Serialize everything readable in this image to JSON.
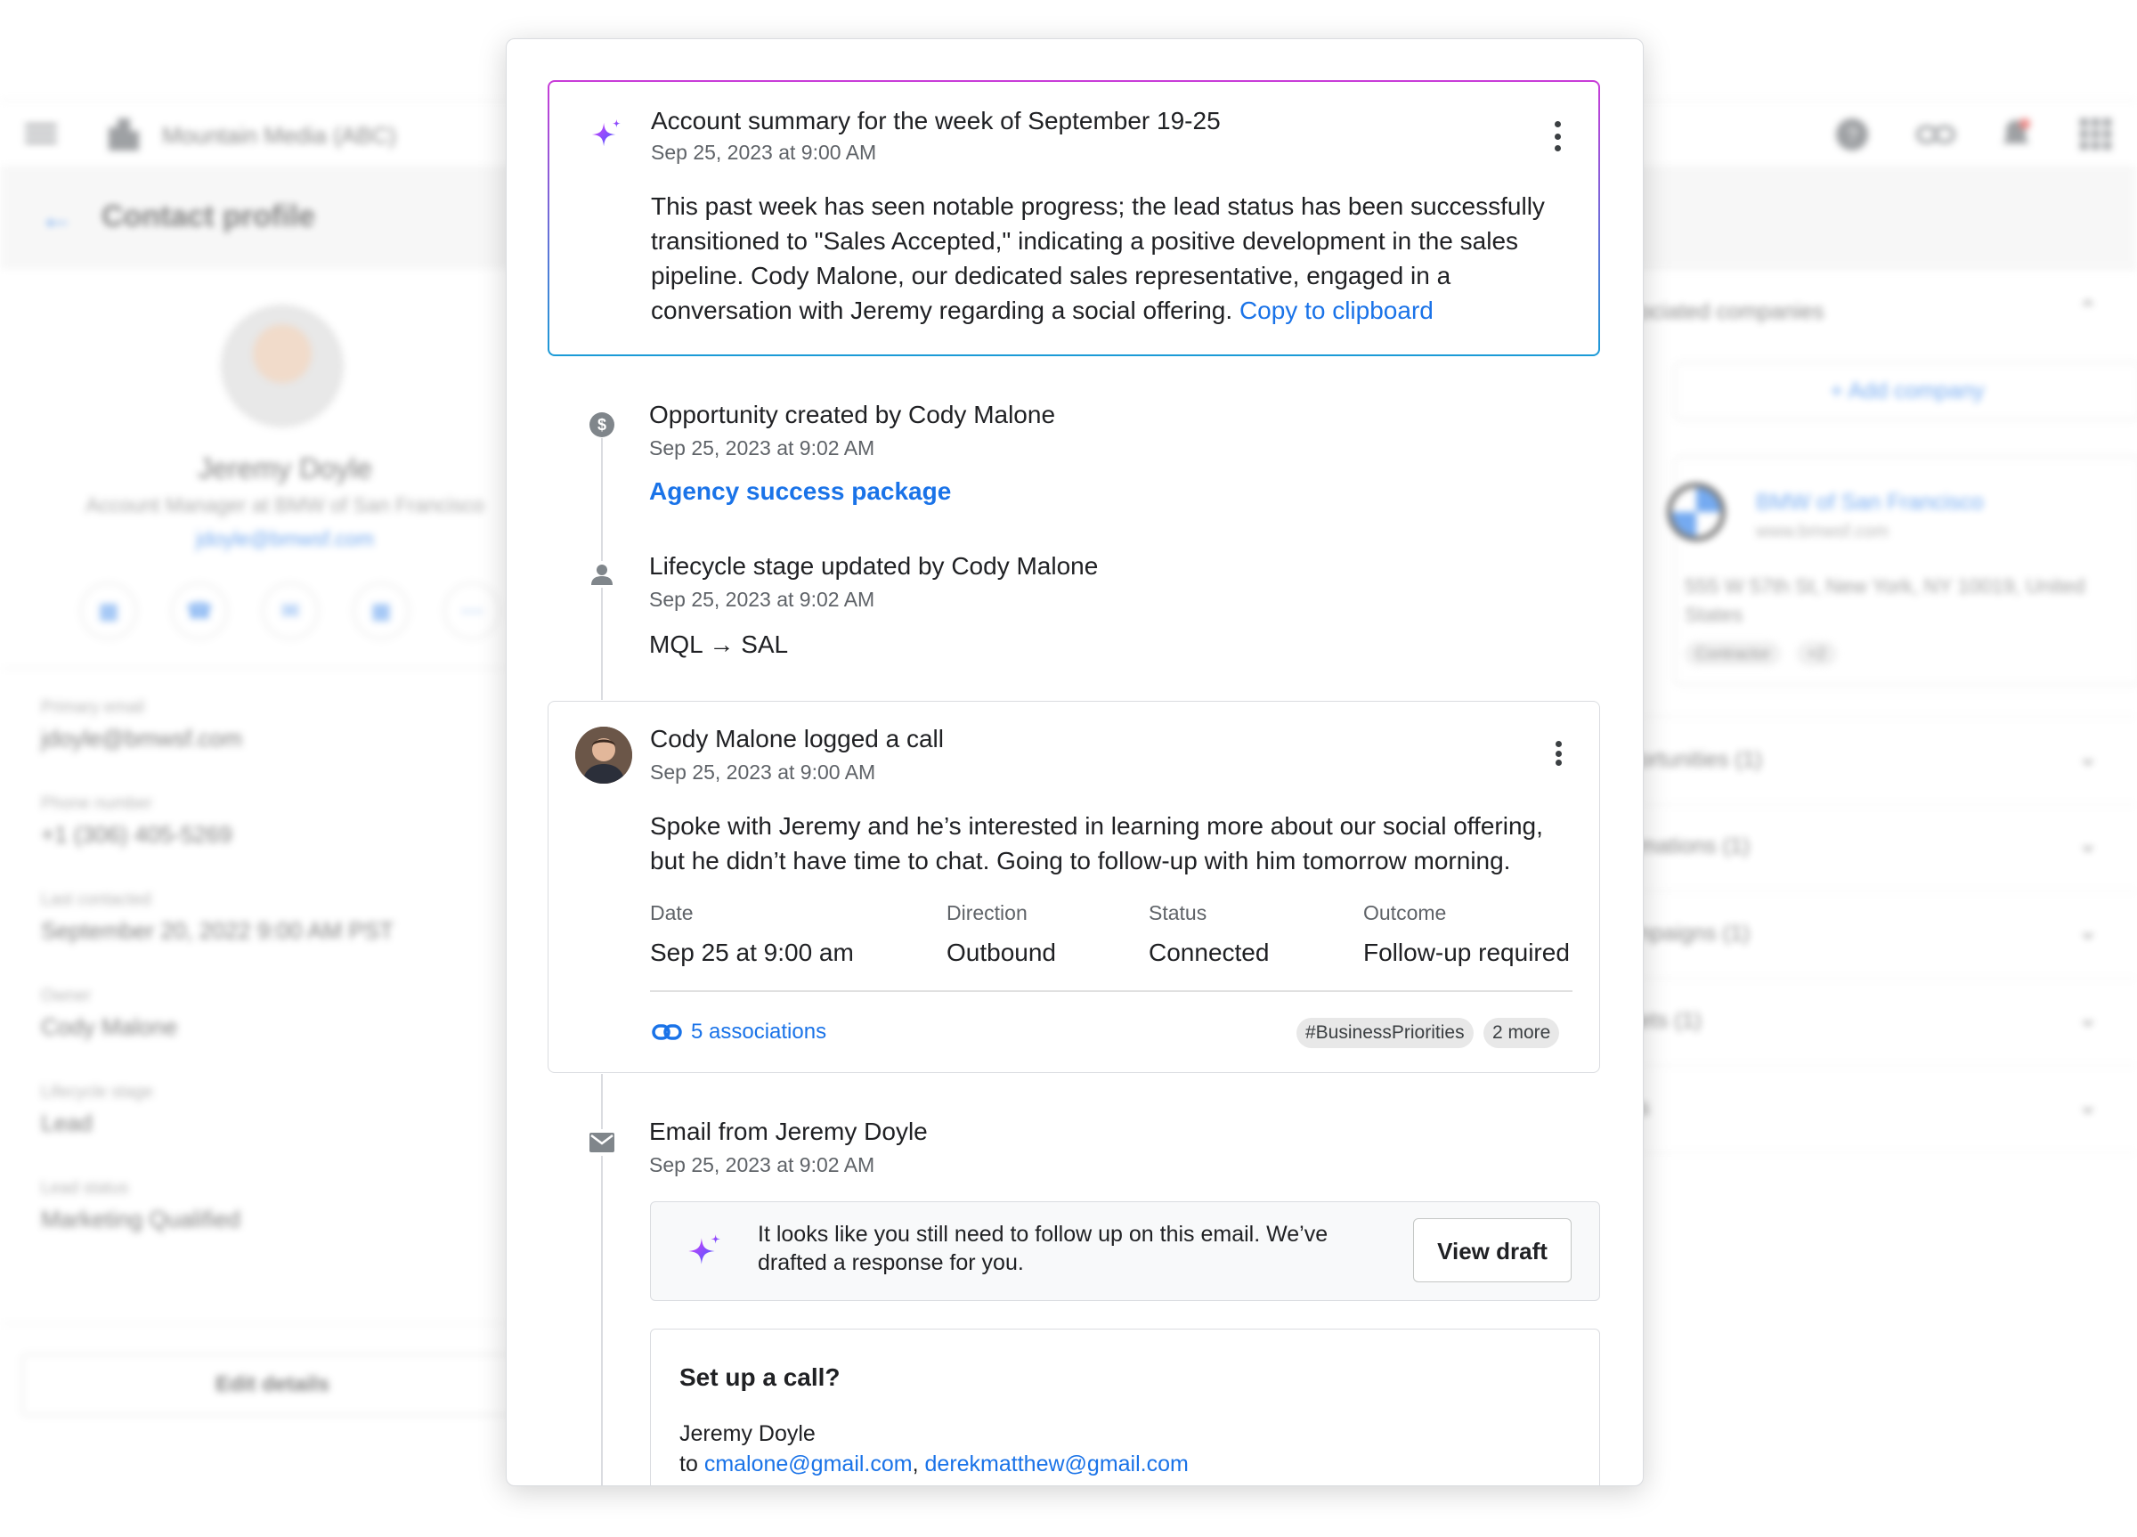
{
  "background": {
    "org_name": "Mountain Media (ABC)",
    "page_title": "Contact profile",
    "contact": {
      "name": "Jeremy Doyle",
      "role": "Account Manager at BMW of San Francisco",
      "email": "jdoyle@bmwsf.com"
    },
    "fields": [
      {
        "label": "Primary email",
        "value": "jdoyle@bmwsf.com"
      },
      {
        "label": "Phone number",
        "value": "+1 (306) 405-5269"
      },
      {
        "label": "Last contacted",
        "value": "September 20, 2022 9:00 AM PST"
      },
      {
        "label": "Owner",
        "value": "Cody Malone"
      },
      {
        "label": "Lifecycle stage",
        "value": "Lead"
      },
      {
        "label": "Lead status",
        "value": "Marketing Qualified"
      }
    ],
    "edit_details_label": "Edit details",
    "right_panel": {
      "associated_companies_title": "ociated companies",
      "add_company_label": "+ Add company",
      "company": {
        "name": "BMW of San Francisco",
        "url": "www.bmwsf.com",
        "address": "555 W 57th St, New York, NY 10019, United States",
        "tag": "Contractor",
        "extra_tag": "+2"
      },
      "sections": [
        "ortunities (1)",
        "mations (1)",
        "npaigns (1)",
        "ets (1)",
        "s"
      ]
    }
  },
  "summary": {
    "title": "Account summary for the week of September 19-25",
    "timestamp": "Sep 25, 2023 at 9:00 AM",
    "body": "This past week has seen notable progress; the lead status has been successfully transitioned to \"Sales Accepted,\" indicating a positive development in the sales pipeline. Cody Malone, our dedicated sales representative, engaged in a conversation with Jeremy regarding a social offering.",
    "copy_link": "Copy to clipboard"
  },
  "opportunity": {
    "title": "Opportunity created by Cody Malone",
    "timestamp": "Sep 25, 2023 at 9:02 AM",
    "link": "Agency success package"
  },
  "lifecycle": {
    "title": "Lifecycle stage updated by Cody Malone",
    "timestamp": "Sep 25, 2023 at 9:02 AM",
    "change": "MQL → SAL"
  },
  "call": {
    "title": "Cody Malone logged a call",
    "timestamp": "Sep 25, 2023 at 9:00 AM",
    "body": "Spoke with Jeremy and he’s interested in learning more about our social offering, but he didn’t have time to chat. Going to follow-up with him tomorrow morning.",
    "details": [
      {
        "label": "Date",
        "value": "Sep 25 at 9:00 am"
      },
      {
        "label": "Direction",
        "value": "Outbound"
      },
      {
        "label": "Status",
        "value": "Connected"
      },
      {
        "label": "Outcome",
        "value": "Follow-up required"
      }
    ],
    "associations": "5 associations",
    "tag": "#BusinessPriorities",
    "more": "2 more"
  },
  "email": {
    "title": "Email from Jeremy Doyle",
    "timestamp": "Sep 25, 2023 at 9:02 AM",
    "ai_suggestion": "It looks like you still need to follow up on this email. We’ve drafted a response for you.",
    "view_draft": "View draft",
    "draft": {
      "subject": "Set up a call?",
      "from": "Jeremy Doyle",
      "to_prefix": "to",
      "to_1": "cmalone@gmail.com",
      "separator": ",",
      "to_2": "derekmatthew@gmail.com"
    }
  },
  "colors": {
    "accent": "#1a73e8",
    "ai_gradient_top": "#c93bd8",
    "ai_gradient_bottom": "#1a9bd7"
  }
}
